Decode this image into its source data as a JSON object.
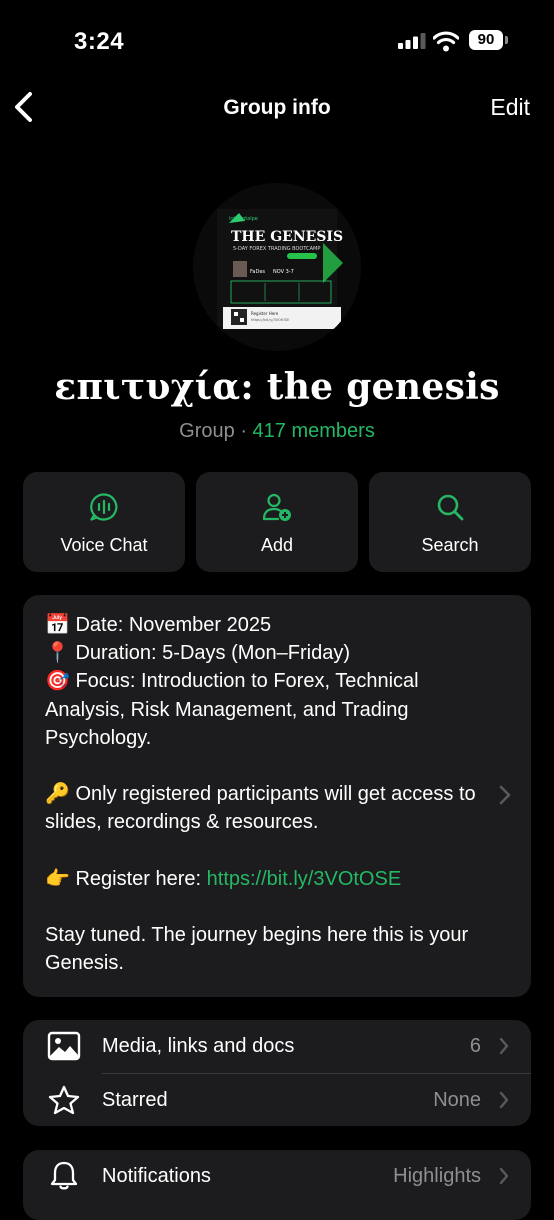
{
  "status_bar": {
    "time": "3:24",
    "battery": "90"
  },
  "nav": {
    "title": "Group info",
    "edit_label": "Edit"
  },
  "group": {
    "name": "επιτυχία: the genesis",
    "type_label": "Group",
    "separator": " · ",
    "members": "417 members"
  },
  "avatar_poster": {
    "brand": "interiqtalpe",
    "title": "THE GENESIS",
    "subtitle": "5-DAY FOREX TRADING BOOTCAMP",
    "host_name": "FaDes",
    "dates": "NOV 3-7",
    "register": "Register Here",
    "register_url": "https://bit.ly/3VOtOSE"
  },
  "actions": [
    {
      "label": "Voice Chat",
      "icon": "voice-chat-icon"
    },
    {
      "label": "Add",
      "icon": "add-person-icon"
    },
    {
      "label": "Search",
      "icon": "search-icon"
    }
  ],
  "description": {
    "line1": "📅 Date: November 2025",
    "line2": "📍 Duration: 5-Days (Mon–Friday)",
    "line3": "🎯 Focus: Introduction to Forex, Technical Analysis, Risk Management, and Trading Psychology.",
    "line4": "🔑 Only registered participants will get access to slides, recordings & resources.",
    "line5_prefix": "👉 Register here: ",
    "line5_link": "https://bit.ly/3VOtOSE",
    "line6": "Stay tuned. The journey begins here this is your Genesis."
  },
  "rows": {
    "media": {
      "label": "Media, links and docs",
      "value": "6",
      "icon": "photo-icon"
    },
    "starred": {
      "label": "Starred",
      "value": "None",
      "icon": "star-icon"
    },
    "notifications": {
      "label": "Notifications",
      "value": "Highlights",
      "icon": "bell-icon"
    }
  },
  "colors": {
    "accent": "#25b864",
    "card": "#1c1c1e",
    "secondary_text": "#8e8e93"
  }
}
